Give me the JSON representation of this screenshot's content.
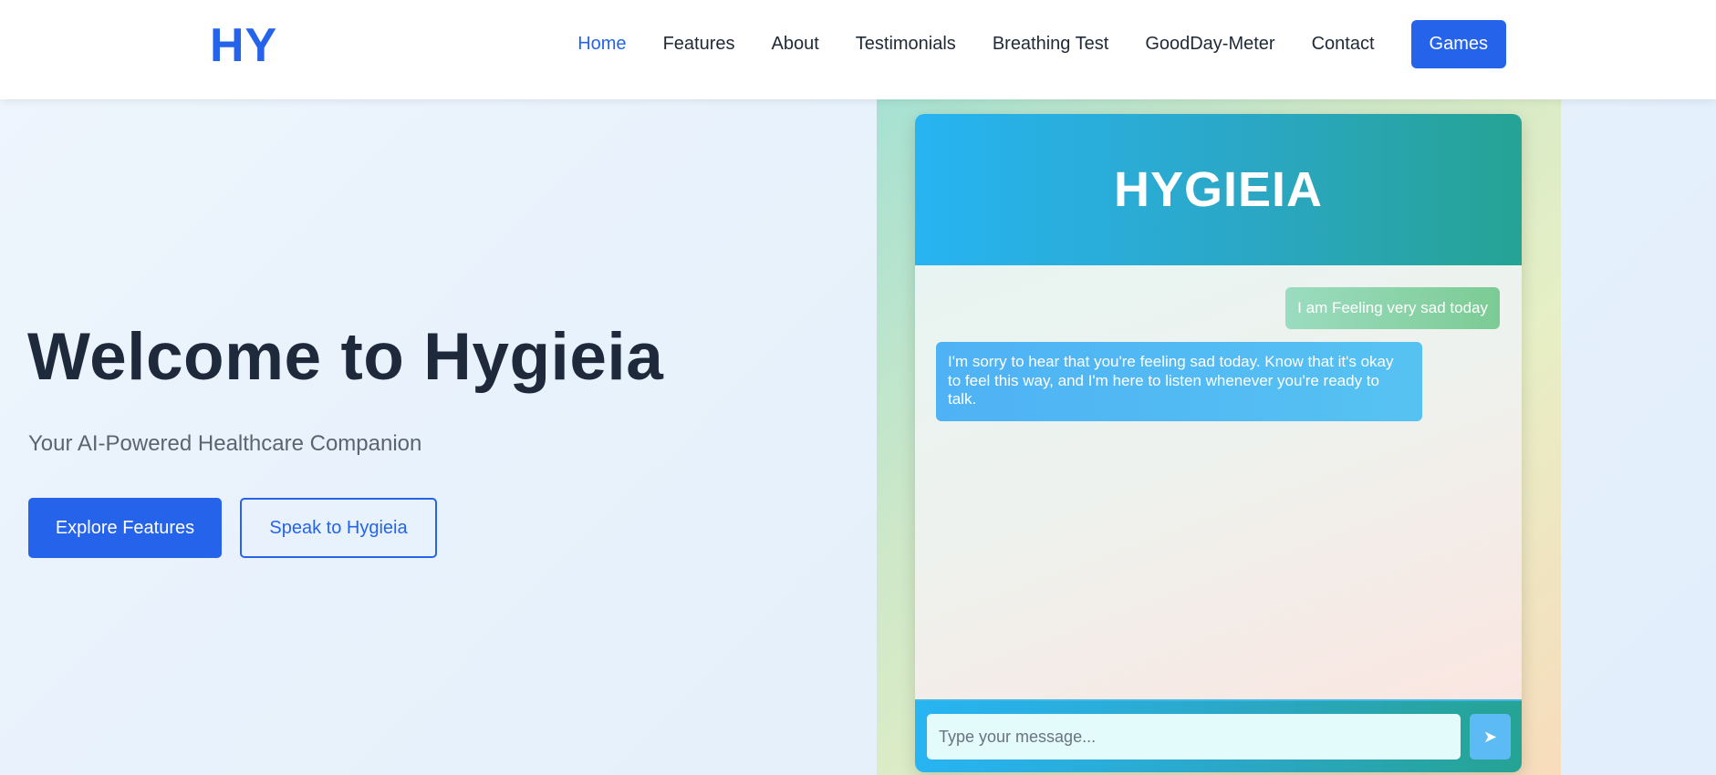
{
  "header": {
    "logo": "HY",
    "nav": [
      {
        "label": "Home",
        "active": true
      },
      {
        "label": "Features"
      },
      {
        "label": "About"
      },
      {
        "label": "Testimonials"
      },
      {
        "label": "Breathing Test"
      },
      {
        "label": "GoodDay-Meter"
      },
      {
        "label": "Contact"
      }
    ],
    "games_label": "Games"
  },
  "hero": {
    "title": "Welcome to Hygieia",
    "subtitle": "Your AI-Powered Healthcare Companion",
    "primary_button": "Explore Features",
    "secondary_button": "Speak to Hygieia"
  },
  "chat": {
    "title": "HYGIEIA",
    "messages": [
      {
        "from": "user",
        "text": "I am Feeling very sad today"
      },
      {
        "from": "bot",
        "text": "I'm sorry to hear that you're feeling sad today. Know that it's okay to feel this way, and I'm here to listen whenever you're ready to talk."
      }
    ],
    "input_placeholder": "Type your message...",
    "input_value": "",
    "send_icon": "send-arrow-icon"
  },
  "colors": {
    "accent": "#2563eb",
    "chat_header_start": "#27b4f2",
    "chat_header_end": "#25a393",
    "user_bubble": "#7ccb94",
    "bot_bubble": "#4fb2f4"
  }
}
